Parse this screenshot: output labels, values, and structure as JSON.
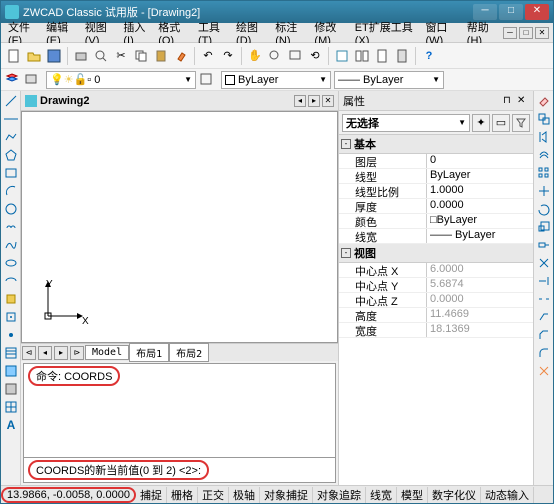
{
  "window": {
    "title": "ZWCAD Classic 试用版 - [Drawing2]"
  },
  "menus": [
    "文件(F)",
    "编辑(E)",
    "视图(V)",
    "插入(I)",
    "格式(O)",
    "工具(T)",
    "绘图(D)",
    "标注(N)",
    "修改(M)",
    "ET扩展工具(X)",
    "窗口(W)",
    "帮助(H)"
  ],
  "doc": {
    "name": "Drawing2"
  },
  "layer_combo": "0",
  "bylayer1": "ByLayer",
  "bylayer2": "ByLayer",
  "modeltabs": [
    "Model",
    "布局1",
    "布局2"
  ],
  "ucs": {
    "x": "X",
    "y": "Y"
  },
  "cmd": {
    "line1_prefix": "命令: ",
    "line1_cmd": "COORDS",
    "prompt": "COORDS的新当前值(0 到 2) <2>:"
  },
  "props": {
    "panel_title": "属性",
    "selector": "无选择",
    "groups": [
      {
        "name": "基本",
        "rows": [
          {
            "k": "图层",
            "v": "0"
          },
          {
            "k": "线型",
            "v": "ByLayer"
          },
          {
            "k": "线型比例",
            "v": "1.0000"
          },
          {
            "k": "厚度",
            "v": "0.0000"
          },
          {
            "k": "颜色",
            "v": "□ByLayer"
          },
          {
            "k": "线宽",
            "v": "—— ByLayer"
          }
        ]
      },
      {
        "name": "视图",
        "rows": [
          {
            "k": "中心点 X",
            "v": "6.0000",
            "dim": true
          },
          {
            "k": "中心点 Y",
            "v": "5.6874",
            "dim": true
          },
          {
            "k": "中心点 Z",
            "v": "0.0000",
            "dim": true
          },
          {
            "k": "高度",
            "v": "11.4669",
            "dim": true
          },
          {
            "k": "宽度",
            "v": "18.1369",
            "dim": true
          }
        ]
      }
    ]
  },
  "status": {
    "coords": "13.9866, -0.0058, 0.0000",
    "buttons": [
      "捕捉",
      "栅格",
      "正交",
      "极轴",
      "对象捕捉",
      "对象追踪",
      "线宽",
      "模型",
      "数字化仪",
      "动态输入"
    ]
  }
}
